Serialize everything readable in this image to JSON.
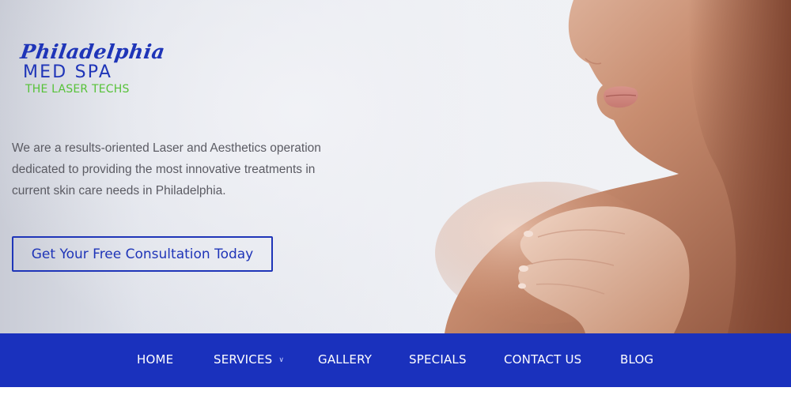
{
  "logo": {
    "script": "Philadelphia",
    "main": "MED SPA",
    "tagline": "THE LASER TECHS"
  },
  "hero": {
    "intro": "We are a results-oriented Laser and Aesthetics operation dedicated to providing the most innovative treatments in current skin care needs in Philadelphia.",
    "cta_label": "Get Your Free Consultation Today"
  },
  "nav": {
    "home": "HOME",
    "services": "SERVICES",
    "gallery": "GALLERY",
    "specials": "SPECIALS",
    "contact": "CONTACT US",
    "blog": "BLOG"
  },
  "icons": {
    "services_caret": "chevron-down-icon"
  },
  "colors": {
    "brand_blue": "#1f35b8",
    "nav_blue": "#1a31bd",
    "tagline_green": "#56c238",
    "body_text": "#5b5b63"
  }
}
